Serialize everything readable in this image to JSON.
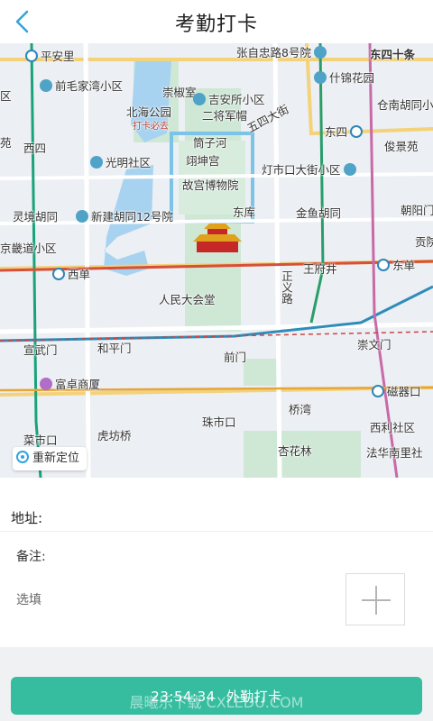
{
  "header": {
    "title": "考勤打卡",
    "back_icon": "chevron-left-icon"
  },
  "map": {
    "pois": {
      "pinganli": "平安里",
      "zhangzizhonglu": "张自忠路8号院",
      "dongsishitiao": "东四十条",
      "qianmaojiawan": "前毛家湾小区",
      "chongjiaoshi": "崇椒室",
      "shijinhuayuan": "什锦花园",
      "ou": "区",
      "beihaigongyuan": "北海公园",
      "jixiangsuo": "吉安所小区",
      "cangnanhutong": "仓南胡同小区",
      "dakabiqu": "打卡必去",
      "erjiangjunmao": "二将军帽",
      "yuan": "苑",
      "xisi": "西四",
      "wusidajie": "五四大街",
      "dongsi": "东四",
      "junjingyuan": "俊景苑",
      "tongzihe": "筒子河",
      "kunninggong": "翊坤宫",
      "guangmingshequ": "光明社区",
      "dengshikou": "灯市口大街小区",
      "gugong": "故宫博物院",
      "lingjinghutong": "灵境胡同",
      "xinjianhutong": "新建胡同12号院",
      "dongku": "东库",
      "jinyuhutong": "金鱼胡同",
      "chaoyangmen": "朝阳门",
      "jingjidao": "京畿道小区",
      "gongfu": "贡院",
      "xidan": "西单",
      "wangfujing": "王府井",
      "dongdan": "东单",
      "renmindahuitang": "人民大会堂",
      "zhengyilu": "正义路",
      "xuanwumen": "宣武门",
      "hepingmen": "和平门",
      "qianmen": "前门",
      "chongwenmen": "崇文门",
      "fuzhuoshangsha": "富卓商厦",
      "ciqikou": "磁器口",
      "qiaowan": "桥湾",
      "zhushikou": "珠市口",
      "caishikou": "菜市口",
      "hufangqiao": "虎坊桥",
      "xilishequ": "西利社区",
      "xinglin": "杏花林",
      "fahuasinanli": "法华南里社"
    },
    "relocate_label": "重新定位"
  },
  "form": {
    "address_label": "地址:",
    "note_label": "备注:",
    "note_placeholder": "选填",
    "add_photo_icon": "plus-icon"
  },
  "action": {
    "time": "23:54:34",
    "label": "外勤打卡"
  },
  "watermark": "晨曦乐下载 CXLEDU.COM",
  "colors": {
    "accent": "#36bda0",
    "back_arrow": "#33a3dc"
  }
}
